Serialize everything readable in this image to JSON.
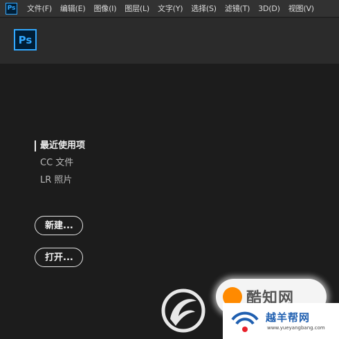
{
  "app": {
    "small_icon_label": "Ps",
    "logo_label": "Ps"
  },
  "menu": [
    {
      "label": "文件(F)"
    },
    {
      "label": "编辑(E)"
    },
    {
      "label": "图像(I)"
    },
    {
      "label": "图层(L)"
    },
    {
      "label": "文字(Y)"
    },
    {
      "label": "选择(S)"
    },
    {
      "label": "滤镜(T)"
    },
    {
      "label": "3D(D)"
    },
    {
      "label": "视图(V)"
    }
  ],
  "nav": {
    "recent": "最近使用项",
    "cc_files": "CC 文件",
    "lr_photos": "LR 照片"
  },
  "buttons": {
    "new": "新建...",
    "open": "打开..."
  },
  "watermark": {
    "badge_text": "酷知网",
    "corner_title": "越羊帮网",
    "corner_url": "www.yueyangbang.com"
  },
  "colors": {
    "ps_blue": "#31a8ff",
    "ps_dark": "#001e36",
    "menubar_bg": "#323232",
    "header_bg": "#2b2b2b",
    "main_bg": "#1c1c1c"
  }
}
